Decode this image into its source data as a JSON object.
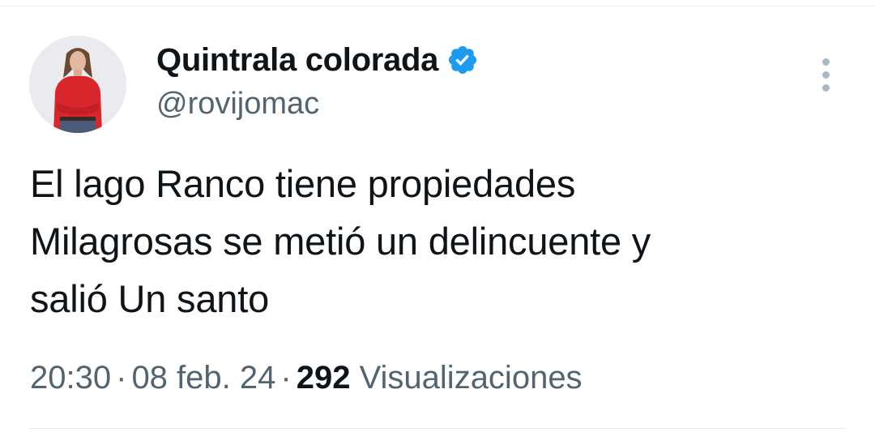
{
  "author": {
    "display_name": "Quintrala colorada",
    "handle": "@rovijomac",
    "verified": true,
    "avatar_icon": "avatar-photo"
  },
  "menu": {
    "icon": "more-vertical-icon"
  },
  "tweet": {
    "lines": [
      "El lago Ranco tiene propiedades",
      "Milagrosas se metió un delincuente y",
      "salió Un santo"
    ]
  },
  "meta": {
    "time": "20:30",
    "separator": "·",
    "date": "08 feb. 24",
    "views_count": "292",
    "views_label": "Visualizaciones"
  },
  "colors": {
    "text": "#0f1419",
    "secondary": "#536471",
    "verified_blue": "#1d9bf0",
    "divider": "#eff3f4"
  }
}
